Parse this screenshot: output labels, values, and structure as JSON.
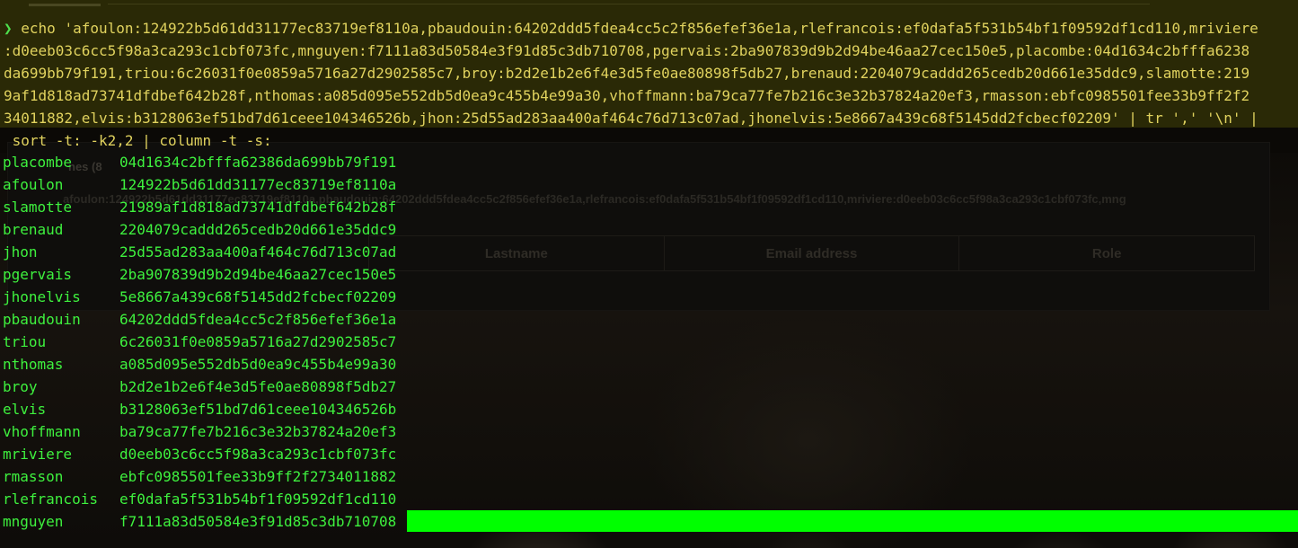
{
  "terminal": {
    "prompt_symbol": "❯",
    "command_lines": [
      "echo 'afoulon:124922b5d61dd31177ec83719ef8110a,pbaudouin:64202ddd5fdea4cc5c2f856efef36e1a,rlefrancois:ef0dafa5f531b54bf1f09592df1cd110,mriviere",
      ":d0eeb03c6cc5f98a3ca293c1cbf073fc,mnguyen:f7111a83d50584e3f91d85c3db710708,pgervais:2ba907839d9b2d94be46aa27cec150e5,placombe:04d1634c2bfffa6238",
      "da699bb79f191,triou:6c26031f0e0859a5716a27d2902585c7,broy:b2d2e1b2e6f4e3d5fe0ae80898f5db27,brenaud:2204079caddd265cedb20d661e35ddc9,slamotte:219",
      "9af1d818ad73741dfdbef642b28f,nthomas:a085d095e552db5d0ea9c455b4e99a30,vhoffmann:ba79ca77fe7b216c3e32b37824a20ef3,rmasson:ebfc0985501fee33b9ff2f2",
      "34011882,elvis:b3128063ef51bd7d61ceee104346526b,jhon:25d55ad283aa400af464c76d713c07ad,jhonelvis:5e8667a439c68f5145dd2fcbecf02209' | tr ',' '\\n' |",
      " sort -t: -k2,2 | column -t -s:"
    ],
    "rows": [
      {
        "user": "placombe",
        "hash": "04d1634c2bfffa62386da699bb79f191"
      },
      {
        "user": "afoulon",
        "hash": "124922b5d61dd31177ec83719ef8110a"
      },
      {
        "user": "slamotte",
        "hash": "21989af1d818ad73741dfdbef642b28f"
      },
      {
        "user": "brenaud",
        "hash": "2204079caddd265cedb20d661e35ddc9"
      },
      {
        "user": "jhon",
        "hash": "25d55ad283aa400af464c76d713c07ad"
      },
      {
        "user": "pgervais",
        "hash": "2ba907839d9b2d94be46aa27cec150e5"
      },
      {
        "user": "jhonelvis",
        "hash": "5e8667a439c68f5145dd2fcbecf02209"
      },
      {
        "user": "pbaudouin",
        "hash": "64202ddd5fdea4cc5c2f856efef36e1a"
      },
      {
        "user": "triou",
        "hash": "6c26031f0e0859a5716a27d2902585c7"
      },
      {
        "user": "nthomas",
        "hash": "a085d095e552db5d0ea9c455b4e99a30"
      },
      {
        "user": "broy",
        "hash": "b2d2e1b2e6f4e3d5fe0ae80898f5db27"
      },
      {
        "user": "elvis",
        "hash": "b3128063ef51bd7d61ceee104346526b"
      },
      {
        "user": "vhoffmann",
        "hash": "ba79ca77fe7b216c3e32b37824a20ef3"
      },
      {
        "user": "mriviere",
        "hash": "d0eeb03c6cc5f98a3ca293c1cbf073fc"
      },
      {
        "user": "rmasson",
        "hash": "ebfc0985501fee33b9ff2f2734011882"
      },
      {
        "user": "rlefrancois",
        "hash": "ef0dafa5f531b54bf1f09592df1cd110"
      },
      {
        "user": "mnguyen",
        "hash": "f7111a83d50584e3f91d85c3db710708"
      }
    ]
  },
  "background_page": {
    "tab_fragment": "nes (8",
    "strip_text": "afoulon:124922b5d61dd31177ec83719ef8110a,pbaudouin:64202ddd5fdea4cc5c2f856efef36e1a,rlefrancois:ef0dafa5f531b54bf1f09592df1cd110,mriviere:d0eeb03c6cc5f98a3ca293c1cbf073fc,mng",
    "table_headers": [
      "Lastname",
      "Email address",
      "Role"
    ]
  },
  "colors": {
    "output_text": "#3ef13e",
    "cursor_block": "#00ff00",
    "command_text": "#e0d25e"
  }
}
